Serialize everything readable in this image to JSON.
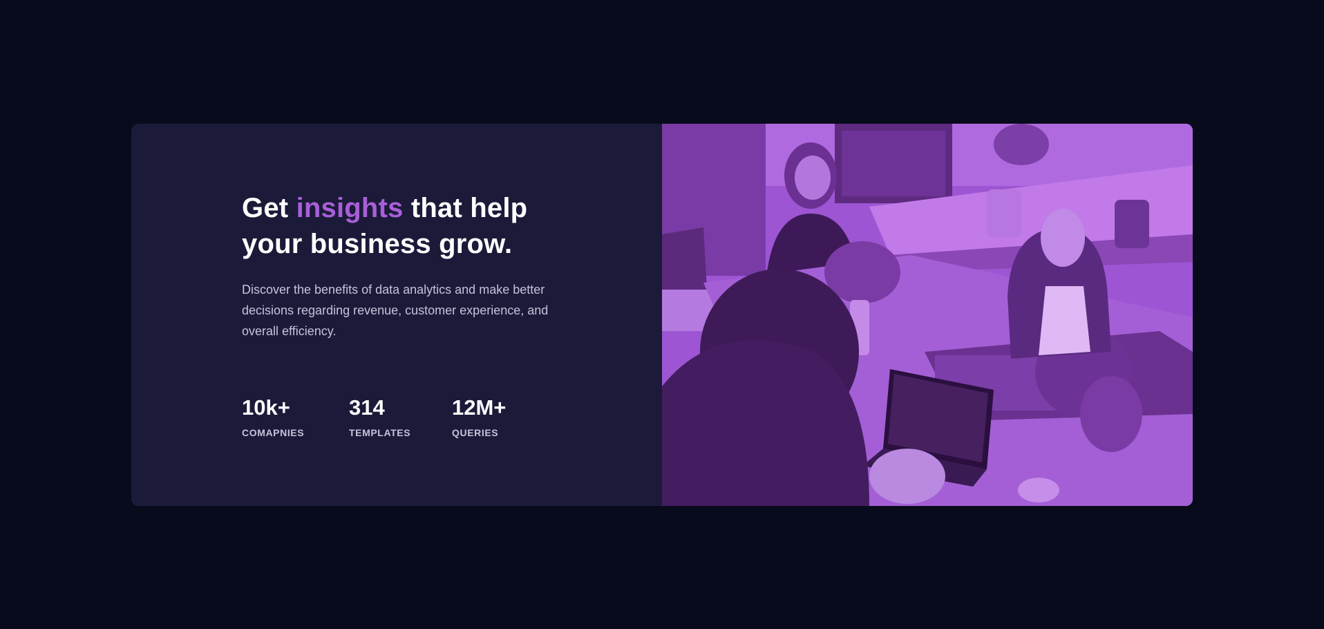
{
  "hero": {
    "headline_prefix": "Get ",
    "headline_accent": "insights",
    "headline_suffix": " that help your business grow.",
    "description": "Discover the benefits of data analytics and make better decisions regarding revenue, customer experience, and overall efficiency."
  },
  "stats": [
    {
      "value": "10k+",
      "label": "COMAPNIES"
    },
    {
      "value": "314",
      "label": "TEMPLATES"
    },
    {
      "value": "12M+",
      "label": "QUERIES"
    }
  ],
  "image": {
    "subject": "team-working-at-office-table-photo",
    "overlay_color": "#a95fd8"
  },
  "colors": {
    "page_background": "#080b1b",
    "card_background": "#1b1a39",
    "accent": "#a95fd8",
    "text_primary": "#ffffff",
    "text_secondary": "#c6c3da"
  }
}
